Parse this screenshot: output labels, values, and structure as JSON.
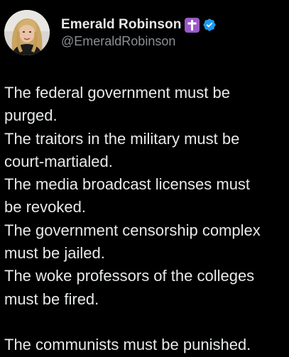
{
  "author": {
    "display_name": "Emerald Robinson",
    "handle": "@EmeraldRobinson",
    "badges": [
      {
        "icon": "cross-icon",
        "color": "#9b59c8"
      },
      {
        "icon": "verified-icon",
        "color": "#1d9bf0"
      }
    ]
  },
  "tweet": {
    "lines": [
      "The federal government must be",
      "purged.",
      "The traitors in the military must be",
      "court-martialed.",
      "The media broadcast licenses must",
      "be revoked.",
      "The government censorship complex",
      "must be jailed.",
      "The woke professors of the colleges",
      "must be fired."
    ],
    "closing_line": "The communists must be punished."
  },
  "colors": {
    "background": "#000000",
    "text": "#e7e9ea",
    "secondary_text": "#8b8f94",
    "verified_blue": "#1d9bf0"
  }
}
